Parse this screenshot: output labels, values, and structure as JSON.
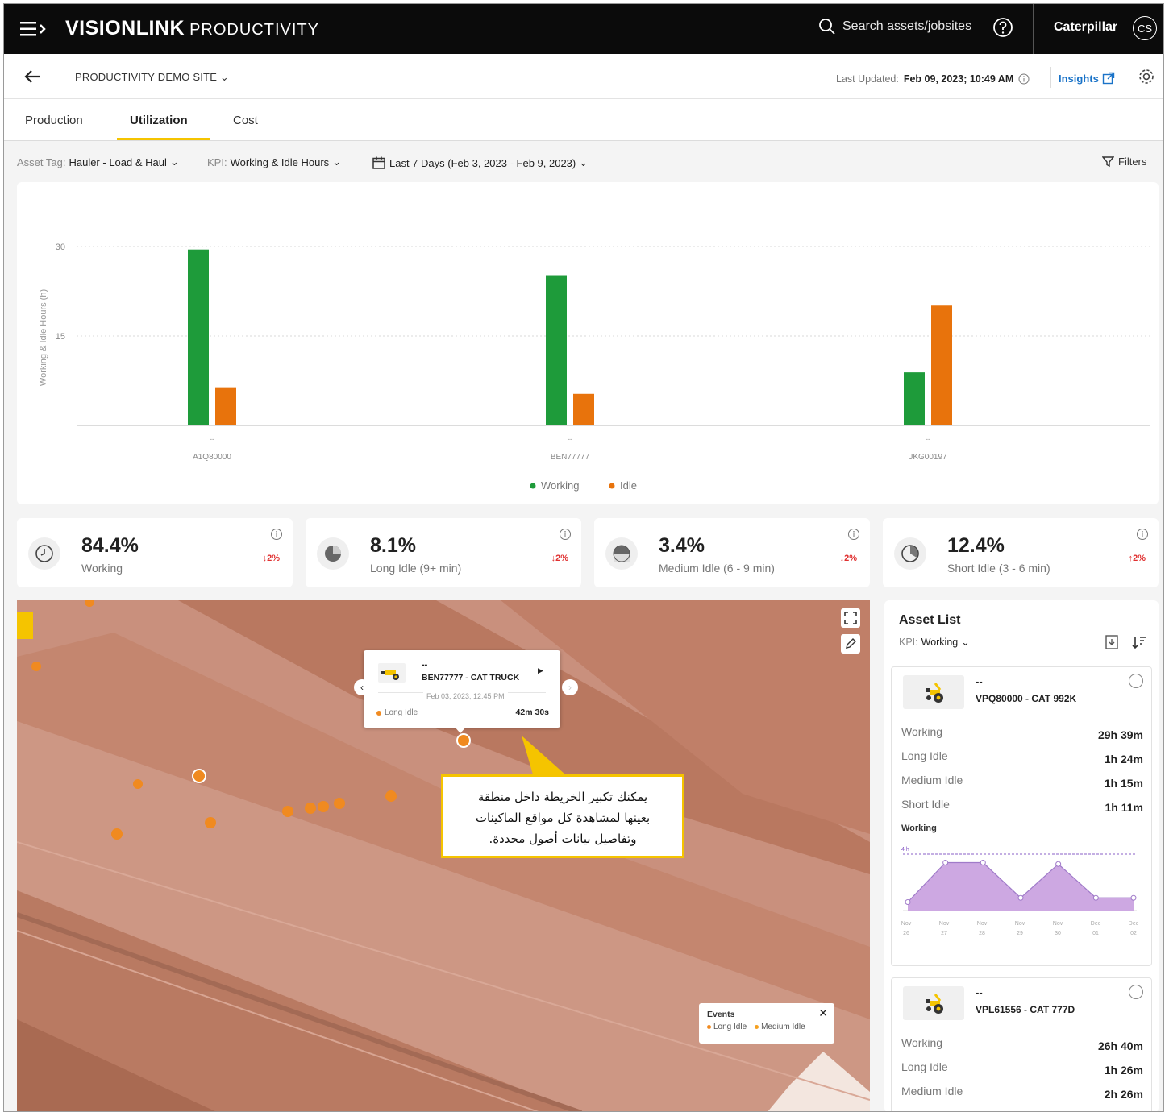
{
  "app": {
    "logo": "VISIONLINK",
    "logo_suffix": "PRODUCTIVITY",
    "search_placeholder": "Search assets/jobsites",
    "company": "Caterpillar",
    "avatar": "CS"
  },
  "subheader": {
    "site": "PRODUCTIVITY DEMO SITE",
    "last_updated_label": "Last Updated:",
    "last_updated_value": "Feb 09, 2023; 10:49 AM",
    "insights": "Insights"
  },
  "tabs": [
    {
      "label": "Production"
    },
    {
      "label": "Utilization",
      "active": true
    },
    {
      "label": "Cost"
    }
  ],
  "filters": {
    "asset_tag_label": "Asset Tag:",
    "asset_tag": "Hauler - Load & Haul",
    "kpi_label": "KPI:",
    "kpi": "Working & Idle Hours",
    "date_range": "Last 7 Days (Feb 3, 2023 - Feb 9, 2023)",
    "filters_button": "Filters"
  },
  "chart_data": {
    "type": "bar",
    "ylabel": "Working & Idle Hours (h)",
    "ylim": [
      0,
      30
    ],
    "yticks": [
      15,
      30
    ],
    "categories": [
      "A1Q80000",
      "BEN77777",
      "JKG00197"
    ],
    "tick_marks": [
      "--",
      "--",
      "--"
    ],
    "series": [
      {
        "name": "Working",
        "color": "#1e9b3a",
        "values": [
          29.5,
          25.2,
          8.9
        ]
      },
      {
        "name": "Idle",
        "color": "#e8730c",
        "values": [
          6.4,
          5.3,
          20.1
        ]
      }
    ],
    "grid": true,
    "legend_position": "bottom-center"
  },
  "kpis": [
    {
      "value": "84.4%",
      "label": "Working",
      "change": "2%",
      "direction": "down",
      "icon": "clock-icon"
    },
    {
      "value": "8.1%",
      "label": "Long Idle (9+ min)",
      "change": "2%",
      "direction": "down",
      "icon": "long-idle-icon"
    },
    {
      "value": "3.4%",
      "label": "Medium Idle (6 - 9 min)",
      "change": "2%",
      "direction": "down",
      "icon": "medium-idle-icon"
    },
    {
      "value": "12.4%",
      "label": "Short Idle (3 - 6 min)",
      "change": "2%",
      "direction": "up",
      "icon": "short-idle-icon"
    }
  ],
  "map": {
    "popup": {
      "dash": "--",
      "title": "BEN77777 - CAT TRUCK",
      "timestamp": "Feb 03, 2023; 12:45 PM",
      "status": "Long Idle",
      "duration": "42m 30s"
    },
    "callout_lines": [
      "يمكنك تكبير الخريطة داخل منطقة",
      "بعينها لمشاهدة كل مواقع الماكينات",
      "وتفاصيل بيانات أصول محددة."
    ],
    "legend": {
      "title": "Events",
      "items": [
        "Long Idle",
        "Medium Idle"
      ]
    }
  },
  "asset_list": {
    "title": "Asset List",
    "kpi_label": "KPI:",
    "kpi": "Working",
    "assets": [
      {
        "dash": "--",
        "name": "VPQ80000 - CAT 992K",
        "stats": [
          {
            "label": "Working",
            "value": "29h 39m"
          },
          {
            "label": "Long Idle",
            "value": "1h 24m"
          },
          {
            "label": "Medium Idle",
            "value": "1h 15m"
          },
          {
            "label": "Short Idle",
            "value": "1h 11m"
          }
        ],
        "mini_chart": {
          "title": "Working",
          "ytick": "4 h",
          "values": [
            0.6,
            3.4,
            3.4,
            0.9,
            3.3,
            0.9,
            0.9
          ],
          "x_labels": [
            [
              "Nov",
              "26"
            ],
            [
              "Nov",
              "27"
            ],
            [
              "Nov",
              "28"
            ],
            [
              "Nov",
              "29"
            ],
            [
              "Nov",
              "30"
            ],
            [
              "Dec",
              "01"
            ],
            [
              "Dec",
              "02"
            ]
          ]
        }
      },
      {
        "dash": "--",
        "name": "VPL61556 - CAT 777D",
        "stats": [
          {
            "label": "Working",
            "value": "26h 40m"
          },
          {
            "label": "Long Idle",
            "value": "1h 26m"
          },
          {
            "label": "Medium Idle",
            "value": "2h 26m"
          }
        ]
      }
    ]
  },
  "colors": {
    "working": "#1e9b3a",
    "idle": "#e8730c",
    "accent": "#f5c400",
    "link": "#1a73c8",
    "down": "#e03131",
    "up": "#e03131"
  }
}
